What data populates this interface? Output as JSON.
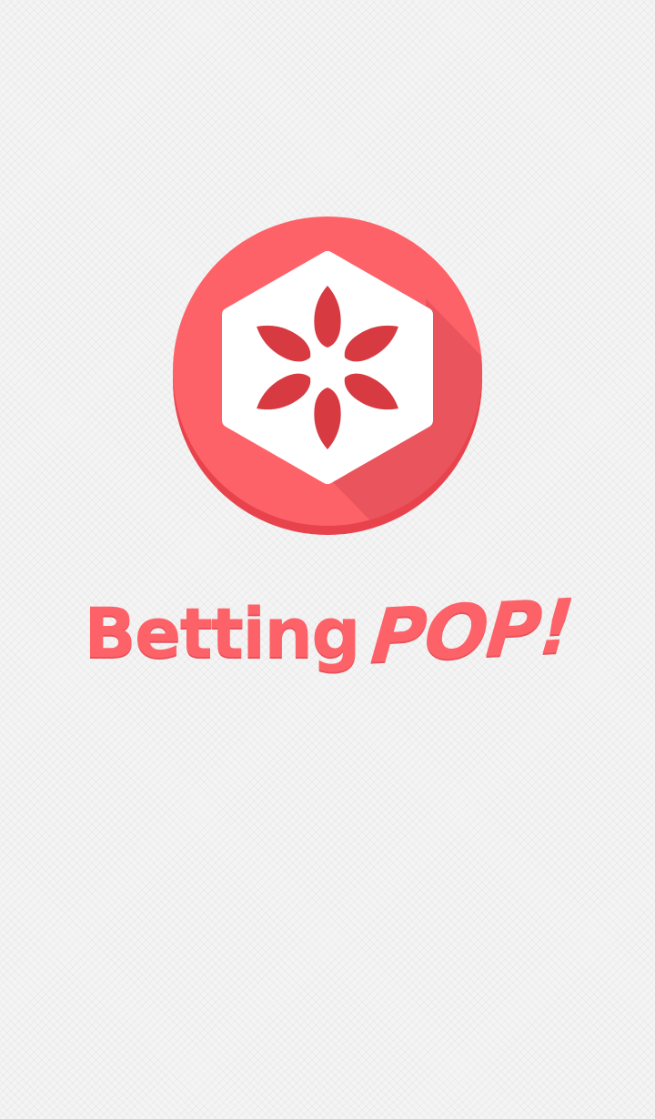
{
  "app": {
    "name_part1": "Betting",
    "name_part2": "POP!"
  },
  "logo": {
    "icon": "hexagon-burst-icon"
  },
  "colors": {
    "brand": "#fd6269",
    "brand_dark": "#e8434c",
    "icon_petal": "#d83a42",
    "background": "#f4f4f4"
  }
}
